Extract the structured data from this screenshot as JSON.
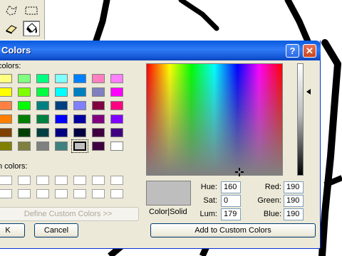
{
  "dialog": {
    "title": "Colors",
    "help_glyph": "?",
    "close_glyph": "✕",
    "basic_colors_label": "colors:",
    "custom_colors_label": "n colors:",
    "define_custom_label": "Define Custom Colors >>",
    "ok_label": "K",
    "cancel_label": "Cancel",
    "color_solid_label": "Color|Solid",
    "add_custom_label": "Add to Custom Colors",
    "hue_label": "Hue:",
    "hue_value": "160",
    "sat_label": "Sat:",
    "sat_value": "0",
    "lum_label": "Lum:",
    "lum_value": "179",
    "red_label": "Red:",
    "red_value": "190",
    "green_label": "Green:",
    "green_value": "190",
    "blue_label": "Blue:",
    "blue_value": "190"
  },
  "basic_colors": [
    [
      "#ffff80",
      "#80ff80",
      "#00ff80",
      "#80ffff",
      "#0080ff",
      "#ff80c0",
      "#ff80ff"
    ],
    [
      "#ffff00",
      "#80ff00",
      "#00ff40",
      "#00ffff",
      "#0080c0",
      "#8080c0",
      "#ff00ff"
    ],
    [
      "#ff8040",
      "#00ff00",
      "#008080",
      "#004080",
      "#8080ff",
      "#800040",
      "#ff0080"
    ],
    [
      "#ff8000",
      "#008000",
      "#008040",
      "#0000ff",
      "#0000a0",
      "#800080",
      "#8000ff"
    ],
    [
      "#804000",
      "#004000",
      "#004040",
      "#000080",
      "#000040",
      "#400040",
      "#400080"
    ],
    [
      "#808000",
      "#808040",
      "#808080",
      "#408080",
      "#c0c0c0",
      "#400040",
      "#ffffff"
    ]
  ],
  "selected_color": "#bebebe",
  "icons": {
    "free_select": "free-form-select-icon",
    "rect_select": "rect-select-icon",
    "eraser": "eraser-icon",
    "fill": "fill-bucket-icon"
  }
}
